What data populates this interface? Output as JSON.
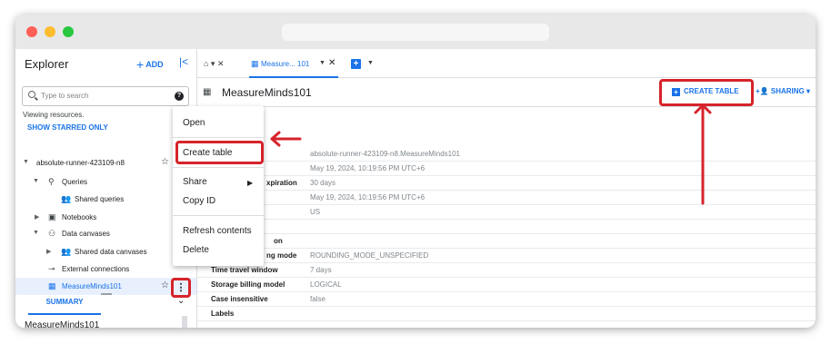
{
  "explorer": {
    "title": "Explorer",
    "add_label": "ADD",
    "search_placeholder": "Type to search",
    "viewing_text": "Viewing resources.",
    "show_starred": "SHOW STARRED ONLY",
    "tree": [
      {
        "label": "absolute-runner-423109-n8"
      },
      {
        "label": "Queries"
      },
      {
        "label": "Shared queries"
      },
      {
        "label": "Notebooks"
      },
      {
        "label": "Data canvases"
      },
      {
        "label": "Shared data canvases"
      },
      {
        "label": "External connections"
      },
      {
        "label": "MeasureMinds101"
      }
    ],
    "summary_tab": "SUMMARY",
    "bottom_name": "MeasureMinds101"
  },
  "context_menu": {
    "items": [
      "Open",
      "Create table",
      "Share",
      "Copy ID",
      "Refresh contents",
      "Delete"
    ]
  },
  "tabs": {
    "active_label": "Measure... 101"
  },
  "dataset": {
    "title": "MeasureMinds101",
    "create_table": "CREATE TABLE",
    "sharing": "SHARING",
    "info_title": "nfo",
    "rows": [
      {
        "key": "",
        "value": "absolute-runner-423109-n8.MeasureMinds101"
      },
      {
        "key": "",
        "value": "May 19, 2024, 10:19:56 PM UTC+6"
      },
      {
        "key": "xpiration",
        "value": "30 days"
      },
      {
        "key": "",
        "value": "May 19, 2024, 10:19:56 PM UTC+6"
      },
      {
        "key": "",
        "value": "US"
      },
      {
        "key": "",
        "value": ""
      },
      {
        "key": "on",
        "value": ""
      },
      {
        "key": "ng mode",
        "value": "ROUNDING_MODE_UNSPECIFIED"
      },
      {
        "key": "Time travel window",
        "value": "7 days"
      },
      {
        "key": "Storage billing model",
        "value": "LOGICAL"
      },
      {
        "key": "Case insensitive",
        "value": "false"
      },
      {
        "key": "Labels",
        "value": ""
      }
    ]
  },
  "colors": {
    "accent": "#1a73e8",
    "annotation_red": "#d6232a"
  }
}
